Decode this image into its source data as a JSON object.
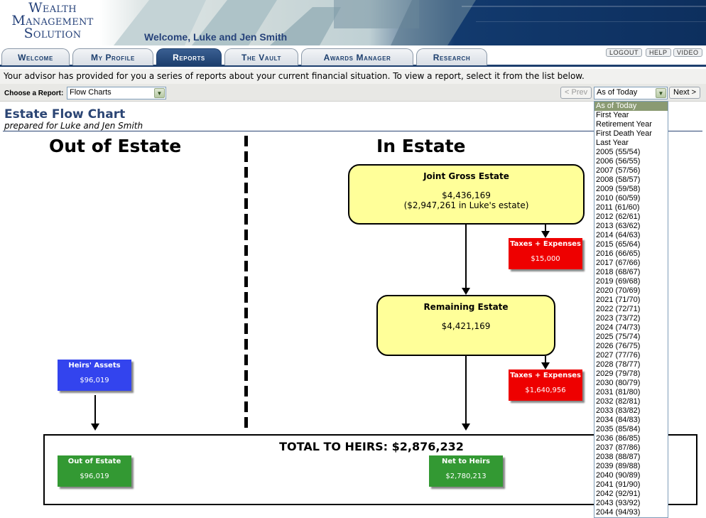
{
  "header": {
    "logo": [
      "Wealth",
      "Management",
      "Solution"
    ],
    "welcome": "Welcome, Luke and Jen Smith"
  },
  "tabs": [
    "Welcome",
    "My Profile",
    "Reports",
    "The Vault",
    "Awards Manager",
    "Research"
  ],
  "active_tab": "Reports",
  "utility_links": {
    "logout": "LOGOUT",
    "help": "HELP",
    "video": "VIDEO"
  },
  "intro": "Your advisor has provided for you a series of reports about your current financial situation. To view a report, select it from the list below.",
  "report_selector": {
    "label": "Choose a Report:",
    "value": "Flow Charts"
  },
  "navigation": {
    "prev": "< Prev",
    "next": "Next >",
    "period_value": "As of Today"
  },
  "period_options": [
    "As of Today",
    "First Year",
    "Retirement Year",
    "First Death Year",
    "Last Year",
    "2005 (55/54)",
    "2006 (56/55)",
    "2007 (57/56)",
    "2008 (58/57)",
    "2009 (59/58)",
    "2010 (60/59)",
    "2011 (61/60)",
    "2012 (62/61)",
    "2013 (63/62)",
    "2014 (64/63)",
    "2015 (65/64)",
    "2016 (66/65)",
    "2017 (67/66)",
    "2018 (68/67)",
    "2019 (69/68)",
    "2020 (70/69)",
    "2021 (71/70)",
    "2022 (72/71)",
    "2023 (73/72)",
    "2024 (74/73)",
    "2025 (75/74)",
    "2026 (76/75)",
    "2027 (77/76)",
    "2028 (78/77)",
    "2029 (79/78)",
    "2030 (80/79)",
    "2031 (81/80)",
    "2032 (82/81)",
    "2033 (83/82)",
    "2034 (84/83)",
    "2035 (85/84)",
    "2036 (86/85)",
    "2037 (87/86)",
    "2038 (88/87)",
    "2039 (89/88)",
    "2040 (90/89)",
    "2041 (91/90)",
    "2042 (92/91)",
    "2043 (93/92)",
    "2044 (94/93)"
  ],
  "report": {
    "title": "Estate Flow Chart",
    "subtitle": "prepared for Luke and Jen Smith"
  },
  "flow": {
    "out_heading": "Out of Estate",
    "in_heading": "In Estate",
    "joint_gross": {
      "label": "Joint Gross Estate",
      "value": "$4,436,169",
      "note": "($2,947,261 in Luke's estate)"
    },
    "taxes1": {
      "label": "Taxes + Expenses",
      "value": "$15,000"
    },
    "remaining": {
      "label": "Remaining Estate",
      "value": "$4,421,169"
    },
    "taxes2": {
      "label": "Taxes + Expenses",
      "value": "$1,640,956"
    },
    "heirs_assets": {
      "label": "Heirs' Assets",
      "value": "$96,019"
    },
    "total": "TOTAL TO HEIRS: $2,876,232",
    "out_of_estate": {
      "label": "Out of Estate",
      "value": "$96,019"
    },
    "net_to_heirs": {
      "label": "Net to Heirs",
      "value": "$2,780,213"
    }
  }
}
